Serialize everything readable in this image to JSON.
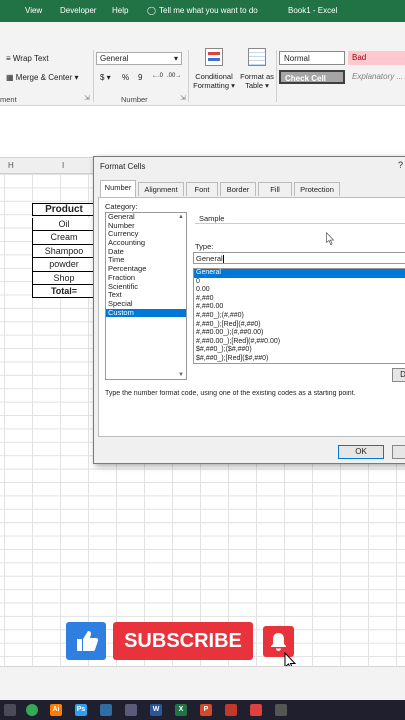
{
  "titlebar": {
    "view": "View",
    "developer": "Developer",
    "help": "Help",
    "tell_me": "Tell me what you want to do",
    "title": "Book1 - Excel"
  },
  "ribbon": {
    "wrap_text": "Wrap Text",
    "merge_center": "Merge & Center",
    "alignment_group": "ment",
    "number_format": "General",
    "currency": "$",
    "percent": "%",
    "comma": "9",
    "number_group": "Number",
    "conditional_formatting": [
      "Conditional",
      "Formatting"
    ],
    "format_as_table": [
      "Format as",
      "Table"
    ],
    "styles": {
      "normal": "Normal",
      "bad": "Bad",
      "check_cell": "Check Cell",
      "explanatory": "Explanatory ..."
    }
  },
  "columns": {
    "h": "H",
    "i": "I"
  },
  "table": {
    "header": "Product",
    "items": [
      "Oil",
      "Cream",
      "Shampoo",
      "powder",
      "Shop"
    ],
    "total": "Total="
  },
  "dialog": {
    "title": "Format Cells",
    "help": "?",
    "tabs": [
      "Number",
      "Alignment",
      "Font",
      "Border",
      "Fill",
      "Protection"
    ],
    "category_label": "Category:",
    "categories": [
      "General",
      "Number",
      "Currency",
      "Accounting",
      "Date",
      "Time",
      "Percentage",
      "Fraction",
      "Scientific",
      "Text",
      "Special",
      "Custom"
    ],
    "selected_category": "Custom",
    "sample_label": "Sample",
    "type_label": "Type:",
    "type_value": "General",
    "types": [
      "General",
      "0",
      "0.00",
      "#,##0",
      "#,##0.00",
      "#,##0_);(#,##0)",
      "#,##0_);[Red](#,##0)",
      "#,##0.00_);(#,##0.00)",
      "#,##0.00_);[Red](#,##0.00)",
      "$#,##0_);($#,##0)",
      "$#,##0_);[Red]($#,##0)"
    ],
    "delete_button": "D",
    "description": "Type the number format code, using one of the existing codes as a starting point.",
    "ok_button": "OK"
  },
  "overlay": {
    "subscribe": "SUBSCRIBE"
  },
  "colors": {
    "excel_green": "#217346",
    "subscribe_red": "#e8323c",
    "like_blue": "#2f7fe0",
    "selection_blue": "#0078d7"
  }
}
